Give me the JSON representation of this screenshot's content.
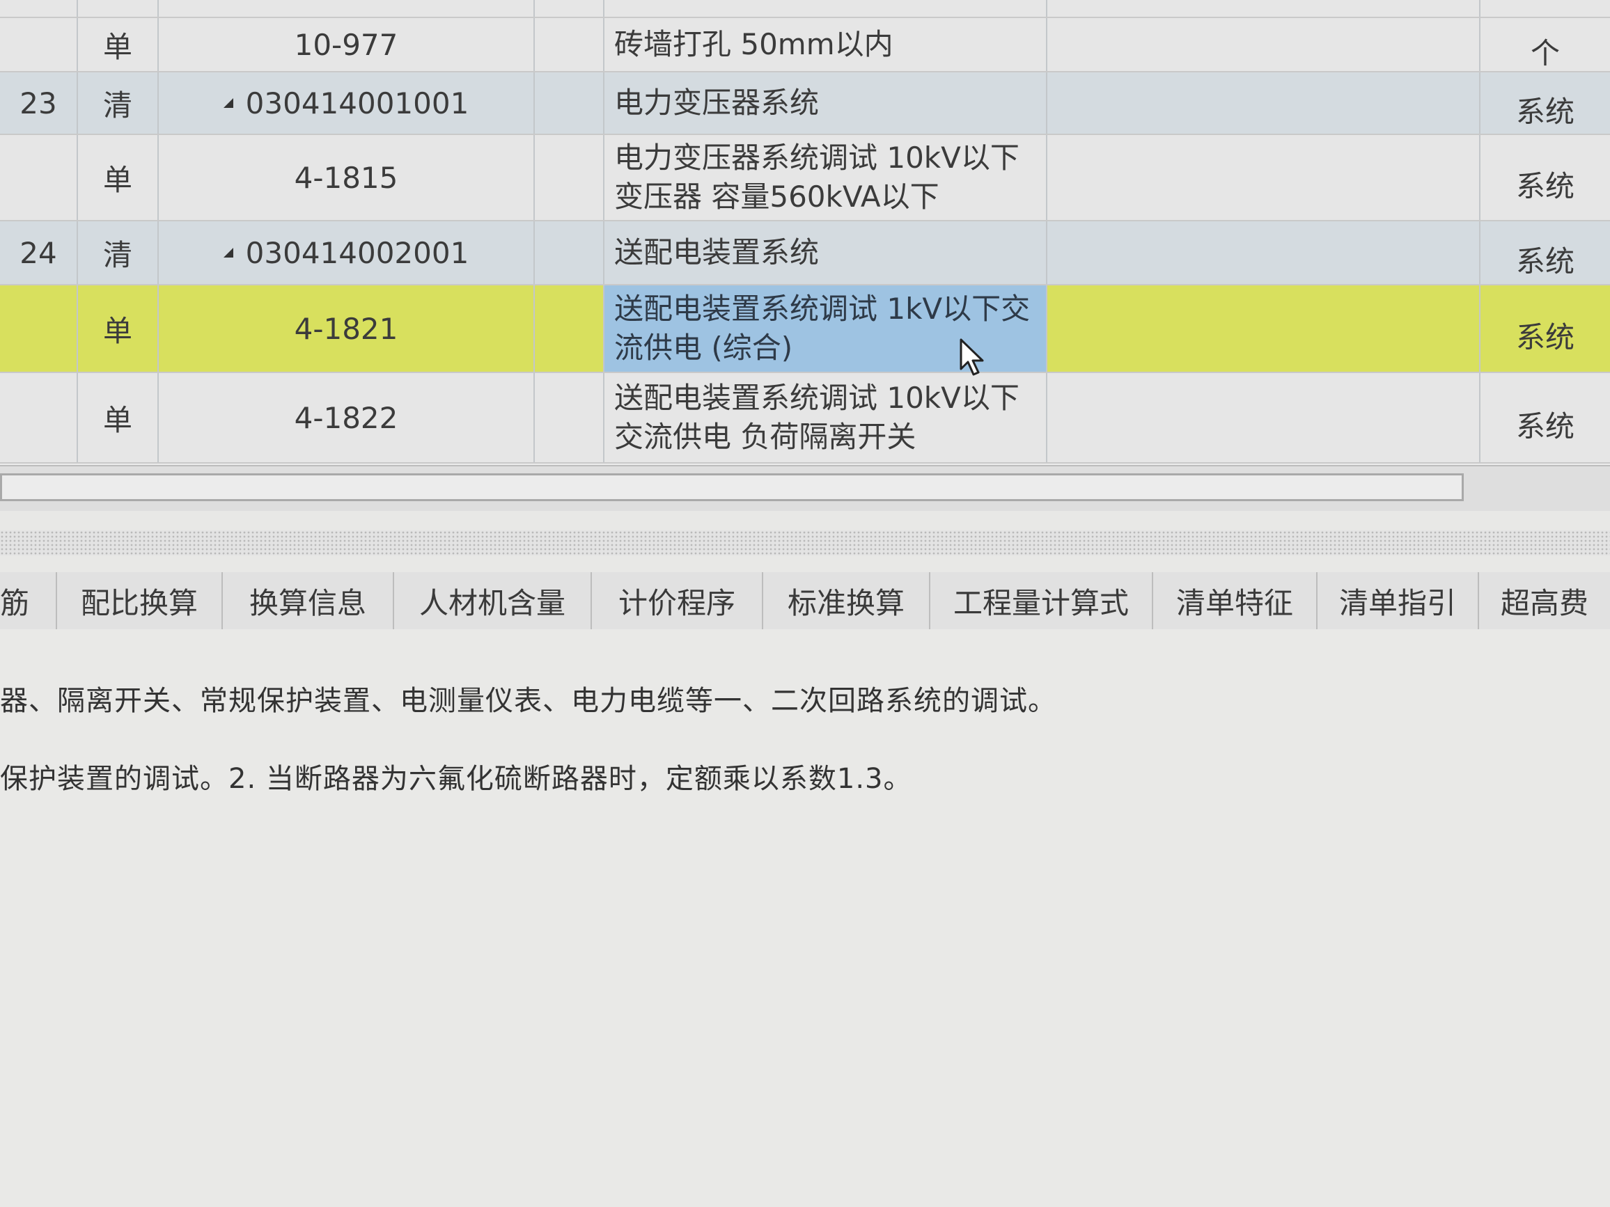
{
  "grid": {
    "rows": [
      {
        "num": "",
        "type": "单",
        "code": "10-977",
        "name": "砖墙打孔 50mm以内",
        "unit": "个",
        "kind": "sub"
      },
      {
        "num": "23",
        "type": "清",
        "code": "030414001001",
        "name": "电力变压器系统",
        "unit": "系统",
        "kind": "clear"
      },
      {
        "num": "",
        "type": "单",
        "code": "4-1815",
        "name": "电力变压器系统调试 10kV以下 变压器 容量560kVA以下",
        "unit": "系统",
        "kind": "sub"
      },
      {
        "num": "24",
        "type": "清",
        "code": "030414002001",
        "name": "送配电装置系统",
        "unit": "系统",
        "kind": "clear"
      },
      {
        "num": "",
        "type": "单",
        "code": "4-1821",
        "name": "送配电装置系统调试 1kV以下交流供电 (综合)",
        "unit": "系统",
        "kind": "selected"
      },
      {
        "num": "",
        "type": "单",
        "code": "4-1822",
        "name": "送配电装置系统调试 10kV以下 交流供电 负荷隔离开关",
        "unit": "系统",
        "kind": "sub"
      }
    ]
  },
  "tabs": [
    "筋",
    "配比换算",
    "换算信息",
    "人材机含量",
    "计价程序",
    "标准换算",
    "工程量计算式",
    "清单特征",
    "清单指引",
    "超高费"
  ],
  "description": {
    "line1": "器、隔离开关、常规保护装置、电测量仪表、电力电缆等一、二次回路系统的调试。",
    "line2": "保护装置的调试。2. 当断路器为六氟化硫断路器时，定额乘以系数1.3。"
  },
  "colors": {
    "selected_row": "#d8e05e",
    "selected_cell": "#9ec3e2",
    "clear_row": "#d4dbe0"
  }
}
